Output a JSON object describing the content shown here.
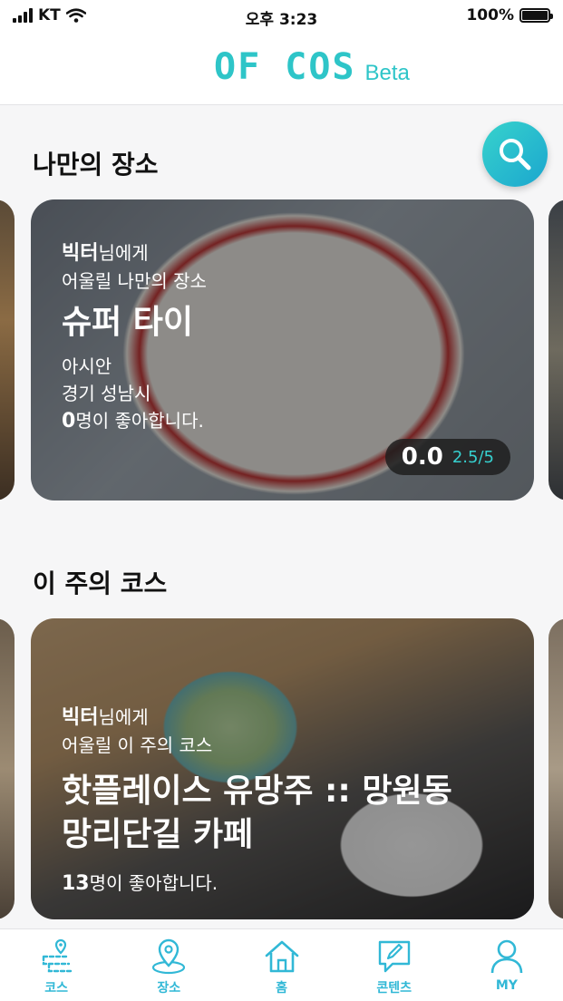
{
  "status_bar": {
    "carrier": "KT",
    "time": "오후 3:23",
    "battery": "100%"
  },
  "header": {
    "logo": "OF COS",
    "logo_suffix": "Beta"
  },
  "my_place": {
    "title": "나만의 장소",
    "card": {
      "user": "빅터",
      "user_suffix": "님에게",
      "subtitle": "어울릴 나만의 장소",
      "name": "슈퍼 타이",
      "category": "아시안",
      "location": "경기 성남시",
      "likes_count": "0",
      "likes_suffix": "명이 좋아합니다.",
      "rating": "0.0",
      "rating_detail": "2.5/5"
    }
  },
  "weekly_course": {
    "title": "이 주의 코스",
    "card": {
      "user": "빅터",
      "user_suffix": "님에게",
      "subtitle": "어울릴 이 주의 코스",
      "name": "핫플레이스 유망주 :: 망원동 망리단길 카페",
      "likes_count": "13",
      "likes_suffix": "명이 좋아합니다."
    }
  },
  "tabbar": {
    "items": [
      {
        "label": "코스",
        "icon": "course-map-icon"
      },
      {
        "label": "장소",
        "icon": "location-pin-icon"
      },
      {
        "label": "홈",
        "icon": "home-icon"
      },
      {
        "label": "콘텐츠",
        "icon": "content-edit-icon"
      },
      {
        "label": "MY",
        "icon": "user-icon"
      }
    ]
  },
  "colors": {
    "accent": "#31b8d6",
    "logo": "#2ec5c8",
    "rating_accent": "#36d0cf"
  }
}
